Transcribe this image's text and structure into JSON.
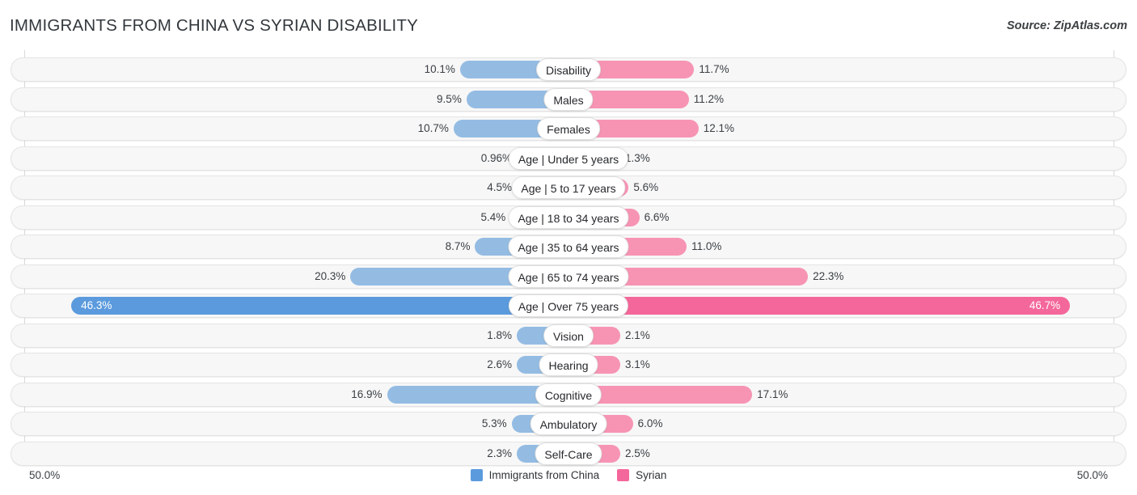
{
  "header": {
    "title": "IMMIGRANTS FROM CHINA VS SYRIAN DISABILITY",
    "source": "Source: ZipAtlas.com"
  },
  "axis": {
    "left_label": "50.0%",
    "right_label": "50.0%",
    "max": 50.0
  },
  "legend": {
    "items": [
      {
        "label": "Immigrants from China",
        "color": "#5b9bdd",
        "icon": "square-swatch-icon"
      },
      {
        "label": "Syrian",
        "color": "#f4679a",
        "icon": "square-swatch-icon"
      }
    ]
  },
  "colors": {
    "left_normal": "#94bce3",
    "right_normal": "#f794b4",
    "left_highlight": "#5b9bdd",
    "right_highlight": "#f4679a",
    "track": "#f7f7f7",
    "gridline": "#d9d9d9"
  },
  "chart_data": {
    "type": "bar",
    "title": "IMMIGRANTS FROM CHINA VS SYRIAN DISABILITY",
    "subtitle": "Source: ZipAtlas.com",
    "orientation": "horizontal-diverging",
    "xlabel": "",
    "ylabel": "",
    "xlim": [
      50.0,
      50.0
    ],
    "grid": true,
    "legend_position": "bottom-center",
    "categories": [
      "Disability",
      "Males",
      "Females",
      "Age | Under 5 years",
      "Age | 5 to 17 years",
      "Age | 18 to 34 years",
      "Age | 35 to 64 years",
      "Age | 65 to 74 years",
      "Age | Over 75 years",
      "Vision",
      "Hearing",
      "Cognitive",
      "Ambulatory",
      "Self-Care"
    ],
    "series": [
      {
        "name": "Immigrants from China",
        "values": [
          10.1,
          9.5,
          10.7,
          0.96,
          4.5,
          5.4,
          8.7,
          20.3,
          46.3,
          1.8,
          2.6,
          16.9,
          5.3,
          2.3
        ],
        "labels": [
          "10.1%",
          "9.5%",
          "10.7%",
          "0.96%",
          "4.5%",
          "5.4%",
          "8.7%",
          "20.3%",
          "46.3%",
          "1.8%",
          "2.6%",
          "16.9%",
          "5.3%",
          "2.3%"
        ]
      },
      {
        "name": "Syrian",
        "values": [
          11.7,
          11.2,
          12.1,
          1.3,
          5.6,
          6.6,
          11.0,
          22.3,
          46.7,
          2.1,
          3.1,
          17.1,
          6.0,
          2.5
        ],
        "labels": [
          "11.7%",
          "11.2%",
          "12.1%",
          "1.3%",
          "5.6%",
          "6.6%",
          "11.0%",
          "22.3%",
          "46.7%",
          "2.1%",
          "3.1%",
          "17.1%",
          "6.0%",
          "2.5%"
        ]
      }
    ],
    "highlighted_rows": [
      8
    ]
  }
}
